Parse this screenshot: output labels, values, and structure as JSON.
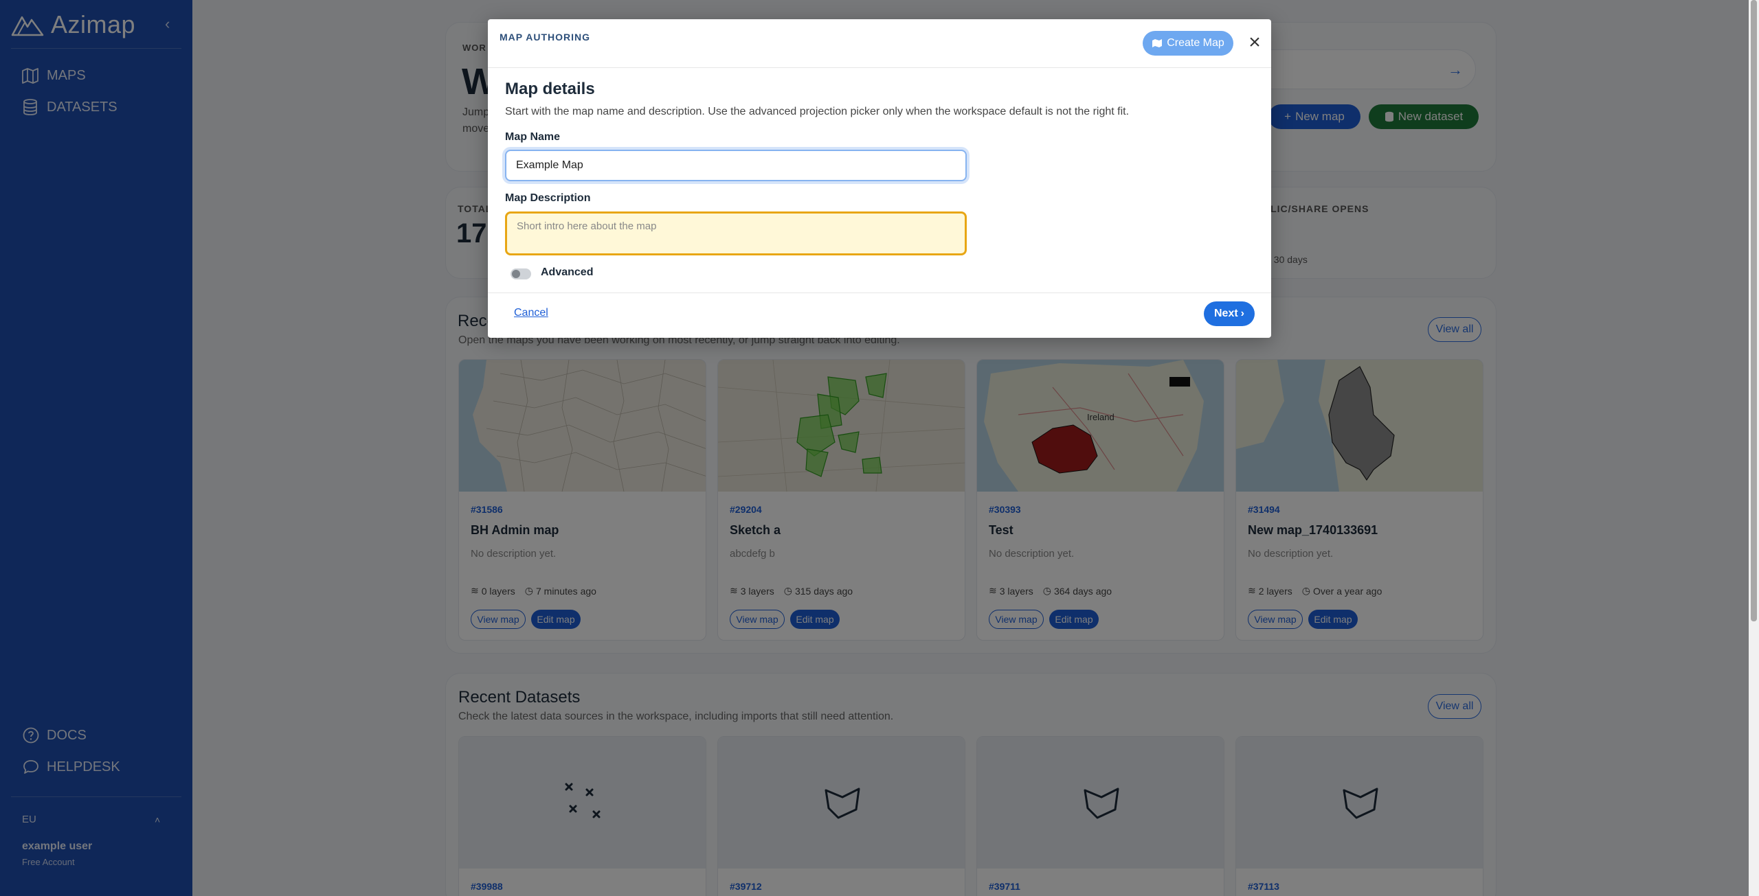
{
  "sidebar": {
    "logo_text": "Azimap",
    "nav": [
      {
        "label": "MAPS",
        "icon": "map-icon"
      },
      {
        "label": "DATASETS",
        "icon": "database-icon"
      }
    ],
    "bottom": [
      {
        "label": "DOCS",
        "icon": "question-circle-icon"
      },
      {
        "label": "HELPDESK",
        "icon": "chat-bubble-icon"
      }
    ],
    "region": "EU",
    "user_name": "example user",
    "plan": "Free Account"
  },
  "hero": {
    "kicker": "WOR",
    "title": "W",
    "sub_line1": "Jump",
    "sub_line2": "move",
    "new_map_label": "New map",
    "new_dataset_label": "New dataset"
  },
  "stats": {
    "label1": "TOTAL",
    "value1": "17",
    "label2": "BLIC/SHARE OPENS",
    "sub2": "t 30 days"
  },
  "recent_maps": {
    "title": "Rece",
    "subtitle": "Open the maps you have been working on most recently, or jump straight back into editing.",
    "view_all": "View all",
    "cards": [
      {
        "id": "#31586",
        "name": "BH Admin map",
        "desc": "No description yet.",
        "layers": "0 layers",
        "time": "7 minutes ago",
        "view": "View map",
        "edit": "Edit map"
      },
      {
        "id": "#29204",
        "name": "Sketch a",
        "desc": "abcdefg b",
        "layers": "3 layers",
        "time": "315 days ago",
        "view": "View map",
        "edit": "Edit map"
      },
      {
        "id": "#30393",
        "name": "Test",
        "desc": "No description yet.",
        "layers": "3 layers",
        "time": "364 days ago",
        "view": "View map",
        "edit": "Edit map"
      },
      {
        "id": "#31494",
        "name": "New map_1740133691",
        "desc": "No description yet.",
        "layers": "2 layers",
        "time": "Over a year ago",
        "view": "View map",
        "edit": "Edit map"
      }
    ],
    "map_labels": {
      "ireland": "Ireland"
    }
  },
  "recent_datasets": {
    "title": "Recent Datasets",
    "subtitle": "Check the latest data sources in the workspace, including imports that still need attention.",
    "view_all": "View all",
    "cards": [
      {
        "id": "#39988"
      },
      {
        "id": "#39712"
      },
      {
        "id": "#39711"
      },
      {
        "id": "#37113"
      }
    ]
  },
  "modal": {
    "kicker": "MAP AUTHORING",
    "create_map_label": "Create Map",
    "title": "Map details",
    "intro": "Start with the map name and description. Use the advanced projection picker only when the workspace default is not the right fit.",
    "name_label": "Map Name",
    "name_value": "Example Map",
    "desc_label": "Map Description",
    "desc_placeholder": "Short intro here about the map",
    "advanced_label": "Advanced",
    "advanced_on": false,
    "cancel_label": "Cancel",
    "next_label": "Next"
  },
  "colors": {
    "sidebar_bg": "#1f4fb0",
    "primary": "#1f5fd6",
    "success": "#1f7a3a",
    "desc_highlight_border": "#e8a614",
    "desc_highlight_bg": "#fff8d8"
  }
}
